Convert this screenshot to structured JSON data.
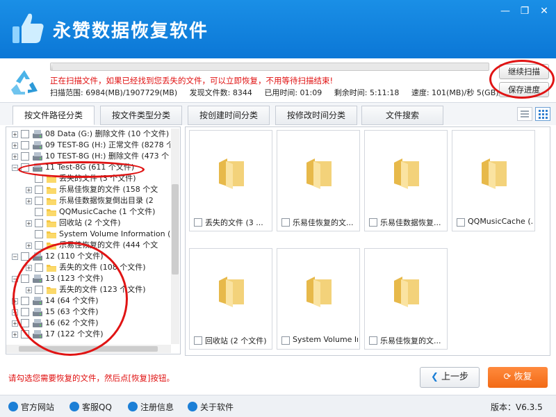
{
  "app": {
    "title": "永赞数据恢复软件",
    "window_controls": {
      "minimize": "—",
      "maximize": "❐",
      "close": "✕"
    }
  },
  "scan": {
    "progress_percent": 0.4,
    "message": "正在扫描文件，如果已经找到您丢失的文件，可以立即恢复，不用等待扫描结束!",
    "range": "扫描范围: 6984(MB)/1907729(MB)",
    "found": "发现文件数: 8344",
    "elapsed": "已用时间: 01:09",
    "remaining": "剩余时间: 5:11:18",
    "speed": "速度: 101(MB)/秒  5(GB)/分",
    "continue_label": "继续扫描",
    "save_label": "保存进度"
  },
  "tabs": [
    {
      "label": "按文件路径分类",
      "active": true
    },
    {
      "label": "按文件类型分类",
      "active": false
    },
    {
      "label": "按创建时间分类",
      "active": false
    },
    {
      "label": "按修改时间分类",
      "active": false
    },
    {
      "label": "文件搜索",
      "active": false
    }
  ],
  "tree": [
    {
      "label": "08 Data (G:) 删除文件 (10 个文件)",
      "icon": "drive"
    },
    {
      "label": "09 TEST-8G (H:) 正常文件 (8278 个",
      "icon": "drive"
    },
    {
      "label": "10 TEST-8G (H:) 删除文件 (473 个",
      "icon": "drive"
    },
    {
      "label": "11 Test-8G  (611 个文件)",
      "icon": "drive"
    },
    {
      "label": "丢失的文件   (3 个文件)",
      "icon": "folder"
    },
    {
      "label": "乐易佳恢复的文件   (158 个文",
      "icon": "folder"
    },
    {
      "label": "乐易佳数据恢复倒出目录   (2",
      "icon": "folder"
    },
    {
      "label": "QQMusicCache   (1 个文件)",
      "icon": "folder"
    },
    {
      "label": "回收站   (2 个文件)",
      "icon": "folder"
    },
    {
      "label": "System Volume Information   (1",
      "icon": "folder"
    },
    {
      "label": "乐易佳恢复的文件   (444 个文",
      "icon": "folder"
    },
    {
      "label": "12   (110 个文件)",
      "icon": "drive"
    },
    {
      "label": "丢失的文件   (108 个文件)",
      "icon": "folder"
    },
    {
      "label": "13   (123 个文件)",
      "icon": "drive"
    },
    {
      "label": "丢失的文件   (123 个文件)",
      "icon": "folder"
    },
    {
      "label": "14   (64 个文件)",
      "icon": "drive"
    },
    {
      "label": "15   (63 个文件)",
      "icon": "drive"
    },
    {
      "label": "16   (62 个文件)",
      "icon": "drive"
    },
    {
      "label": "17   (122 个文件)",
      "icon": "drive"
    }
  ],
  "cards": [
    {
      "label": "丢失的文件 (3 ..."
    },
    {
      "label": "乐易佳恢复的文..."
    },
    {
      "label": "乐易佳数据恢复..."
    },
    {
      "label": "QQMusicCache (..."
    },
    {
      "label": "回收站 (2 个文件)"
    },
    {
      "label": "System Volume In..."
    },
    {
      "label": "乐易佳恢复的文..."
    }
  ],
  "hint": "请勾选您需要恢复的文件，然后点[恢复]按钮。",
  "buttons": {
    "prev": "上一步",
    "restore": "恢复"
  },
  "footer": {
    "links": [
      {
        "label": "官方网站",
        "icon": "home-icon"
      },
      {
        "label": "客服QQ",
        "icon": "qq-icon"
      },
      {
        "label": "注册信息",
        "icon": "register-icon"
      },
      {
        "label": "关于软件",
        "icon": "info-icon"
      }
    ],
    "version": "版本：V6.3.5"
  },
  "colors": {
    "titlebar": "#0b77d6",
    "accent": "#f26a16",
    "alert": "#e01010"
  }
}
